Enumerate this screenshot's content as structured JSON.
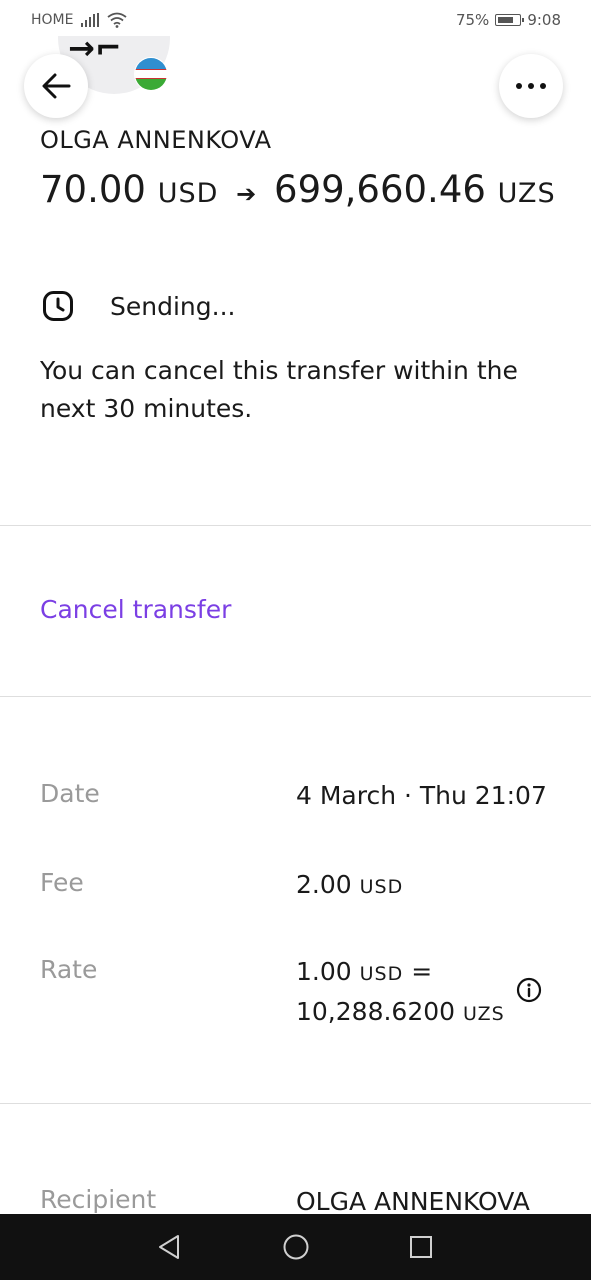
{
  "status_bar": {
    "carrier": "HOME",
    "battery": "75%",
    "time": "9:08"
  },
  "transfer": {
    "recipient_name": "OLGA ANNENKOVA",
    "send_amount": "70.00",
    "send_currency": "USD",
    "receive_amount": "699,660.46",
    "receive_currency": "UZS",
    "status": "Sending...",
    "cancel_note": "You can cancel this transfer within the next 30 minutes.",
    "cancel_label": "Cancel transfer"
  },
  "details": {
    "date_label": "Date",
    "date_value": "4 March · Thu 21:07",
    "fee_label": "Fee",
    "fee_amount": "2.00",
    "fee_currency": "USD",
    "rate_label": "Rate",
    "rate_base_amount": "1.00",
    "rate_base_currency": "USD",
    "rate_equals": "=",
    "rate_amount": "10,288.6200",
    "rate_currency": "UZS",
    "recipient_label": "Recipient",
    "recipient_value": "OLGA ANNENKOVA"
  },
  "colors": {
    "accent": "#7b3fe4",
    "muted": "#9a9a9a",
    "nav_bar": "#111111"
  },
  "icons": [
    "back-arrow-icon",
    "more-icon",
    "clock-icon",
    "info-icon",
    "uzbekistan-flag-icon",
    "nav-back-icon",
    "nav-home-icon",
    "nav-recents-icon"
  ]
}
